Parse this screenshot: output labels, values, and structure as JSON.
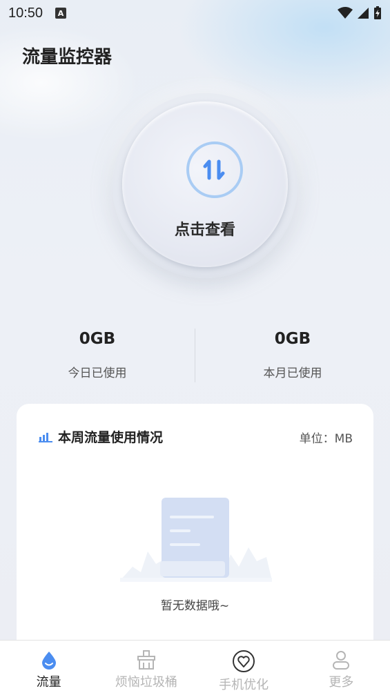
{
  "status_bar": {
    "time": "10:50",
    "notification_icon": "A"
  },
  "app": {
    "title": "流量监控器"
  },
  "meter": {
    "label": "点击查看",
    "icon": "swap-arrows-icon",
    "accent": "#4b8df0"
  },
  "stats": [
    {
      "value": "0GB",
      "label": "今日已使用"
    },
    {
      "value": "0GB",
      "label": "本月已使用"
    }
  ],
  "weekly": {
    "title": "本周流量使用情况",
    "unit": "单位：MB",
    "empty_text": "暂无数据哦~"
  },
  "tabs": [
    {
      "label": "流量",
      "icon": "drop-icon",
      "active": true
    },
    {
      "label": "烦恼垃圾桶",
      "icon": "trash-icon",
      "active": false
    },
    {
      "label": "手机优化",
      "icon": "heart-icon",
      "active": false
    },
    {
      "label": "更多",
      "icon": "user-icon",
      "active": false
    }
  ]
}
